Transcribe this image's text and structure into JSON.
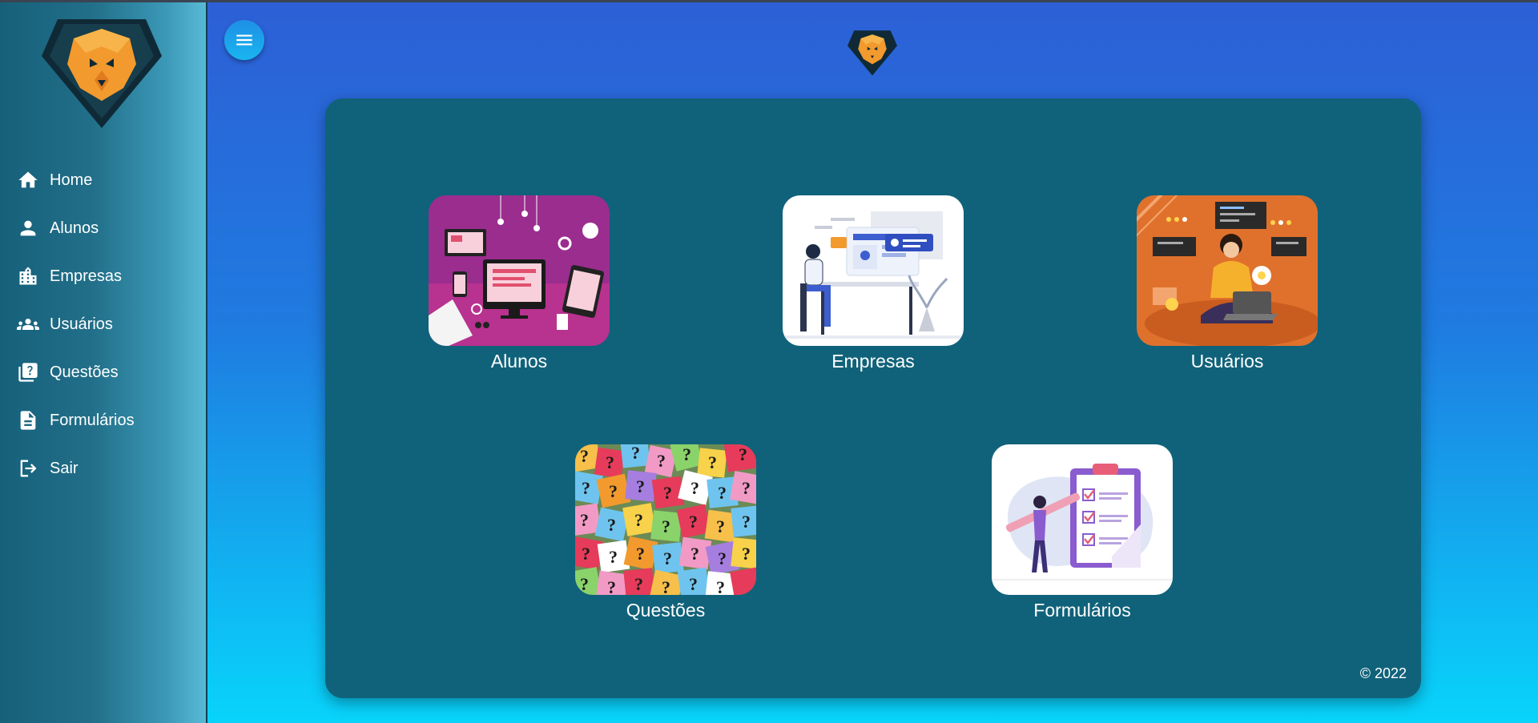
{
  "sidebar": {
    "logo_icon": "lion-shield-logo",
    "items": [
      {
        "label": "Home",
        "icon": "home-icon"
      },
      {
        "label": "Alunos",
        "icon": "person-icon"
      },
      {
        "label": "Empresas",
        "icon": "building-icon"
      },
      {
        "label": "Usuários",
        "icon": "group-icon"
      },
      {
        "label": "Questões",
        "icon": "quiz-icon"
      },
      {
        "label": "Formulários",
        "icon": "document-icon"
      },
      {
        "label": "Sair",
        "icon": "logout-icon"
      }
    ]
  },
  "header": {
    "menu_icon": "hamburger-menu-icon",
    "logo_icon": "lion-shield-logo"
  },
  "main": {
    "tiles": [
      {
        "label": "Alunos",
        "image": "devices-illustration"
      },
      {
        "label": "Empresas",
        "image": "office-worker-illustration"
      },
      {
        "label": "Usuários",
        "image": "woman-laptop-illustration"
      },
      {
        "label": "Questões",
        "image": "question-marks-photo"
      },
      {
        "label": "Formulários",
        "image": "checklist-illustration"
      }
    ],
    "footer": "© 2022"
  },
  "colors": {
    "card": "#10627a",
    "accent_orange": "#f29a2e",
    "background_top": "#2d5fd6",
    "background_bottom": "#08d4fb"
  }
}
